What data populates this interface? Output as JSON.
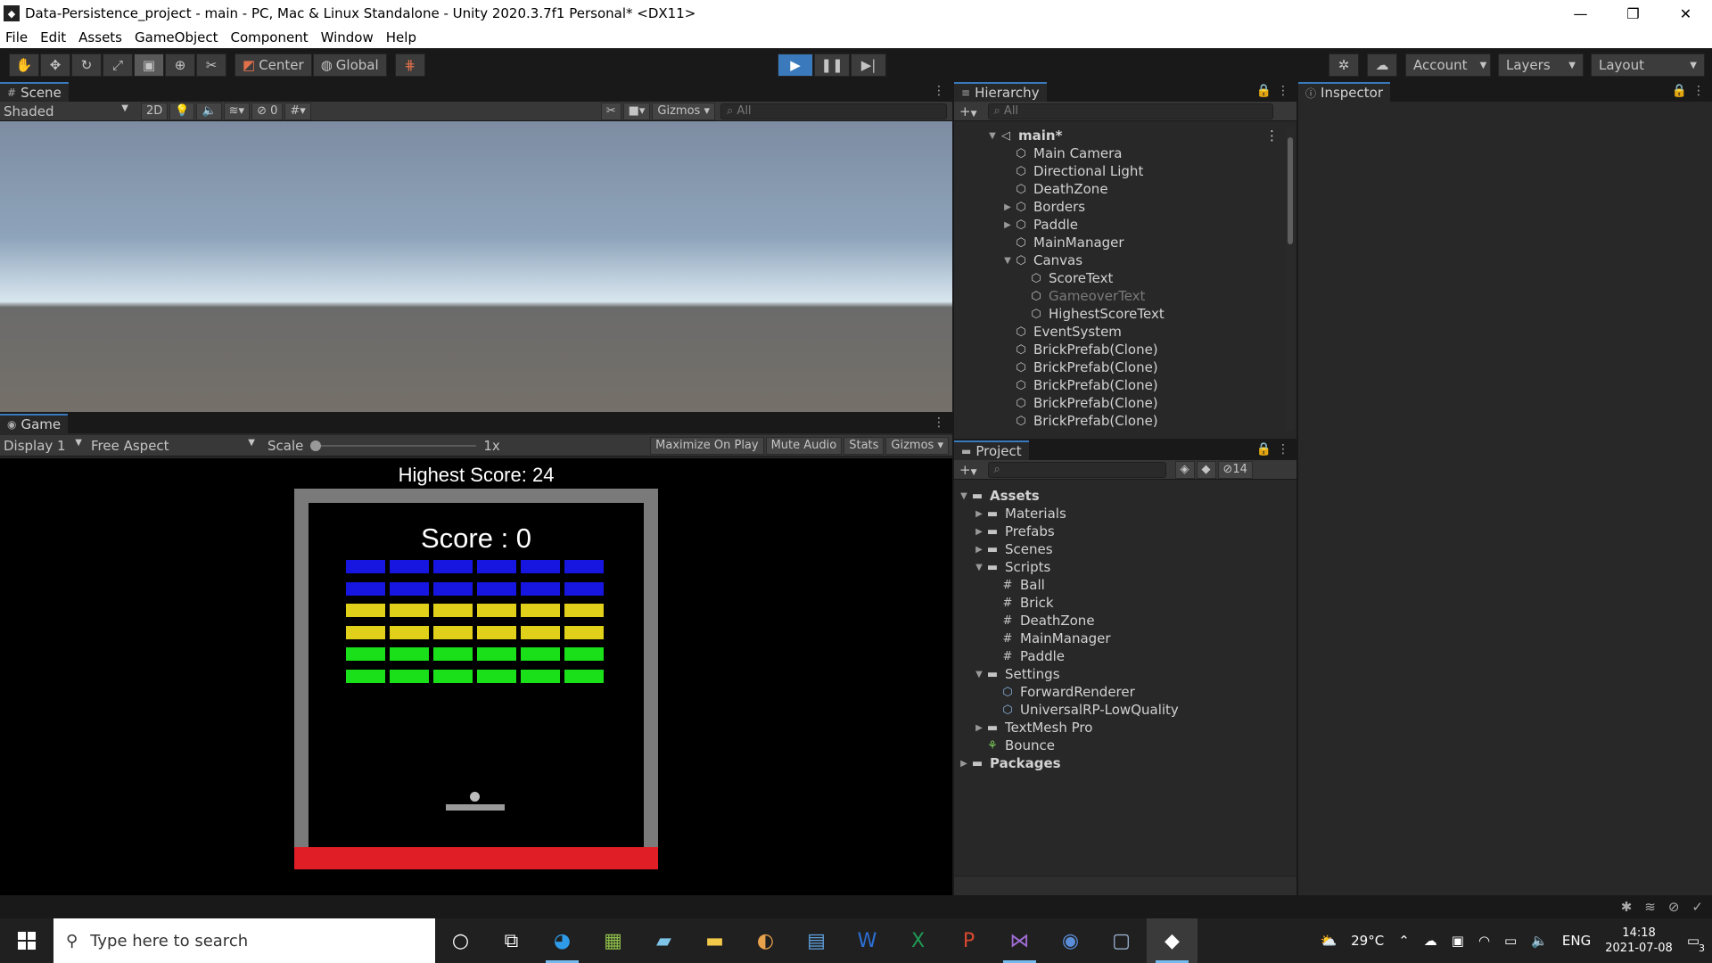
{
  "window": {
    "title": "Data-Persistence_project - main - PC, Mac & Linux Standalone - Unity 2020.3.7f1 Personal* <DX11>"
  },
  "menu": [
    "File",
    "Edit",
    "Assets",
    "GameObject",
    "Component",
    "Window",
    "Help"
  ],
  "toolbar": {
    "pivot": "Center",
    "space": "Global",
    "account": "Account",
    "layers": "Layers",
    "layout": "Layout"
  },
  "scene": {
    "tab": "Scene",
    "shading": "Shaded",
    "mode2d": "2D",
    "hidden_count": "0",
    "gizmos": "Gizmos",
    "search": "All"
  },
  "game": {
    "tab": "Game",
    "display": "Display 1",
    "aspect": "Free Aspect",
    "scale_label": "Scale",
    "scale_value": "1x",
    "maximize": "Maximize On Play",
    "mute": "Mute Audio",
    "stats": "Stats",
    "gizmos": "Gizmos",
    "highest_score": "Highest Score: 24",
    "score": "Score : 0",
    "brick_rows": [
      "#1616e0",
      "#1616e0",
      "#e0d01a",
      "#e0d01a",
      "#19e019",
      "#19e019"
    ],
    "brick_columns": 6
  },
  "hierarchy": {
    "tab": "Hierarchy",
    "search": "All",
    "items": [
      {
        "label": "main*",
        "depth": 0,
        "arrow": "▼",
        "bold": true
      },
      {
        "label": "Main Camera",
        "depth": 1,
        "arrow": ""
      },
      {
        "label": "Directional Light",
        "depth": 1,
        "arrow": ""
      },
      {
        "label": "DeathZone",
        "depth": 1,
        "arrow": ""
      },
      {
        "label": "Borders",
        "depth": 1,
        "arrow": "▶"
      },
      {
        "label": "Paddle",
        "depth": 1,
        "arrow": "▶"
      },
      {
        "label": "MainManager",
        "depth": 1,
        "arrow": ""
      },
      {
        "label": "Canvas",
        "depth": 1,
        "arrow": "▼"
      },
      {
        "label": "ScoreText",
        "depth": 2,
        "arrow": ""
      },
      {
        "label": "GameoverText",
        "depth": 2,
        "arrow": "",
        "dim": true
      },
      {
        "label": "HighestScoreText",
        "depth": 2,
        "arrow": ""
      },
      {
        "label": "EventSystem",
        "depth": 1,
        "arrow": ""
      },
      {
        "label": "BrickPrefab(Clone)",
        "depth": 1,
        "arrow": ""
      },
      {
        "label": "BrickPrefab(Clone)",
        "depth": 1,
        "arrow": ""
      },
      {
        "label": "BrickPrefab(Clone)",
        "depth": 1,
        "arrow": ""
      },
      {
        "label": "BrickPrefab(Clone)",
        "depth": 1,
        "arrow": ""
      },
      {
        "label": "BrickPrefab(Clone)",
        "depth": 1,
        "arrow": ""
      }
    ]
  },
  "project": {
    "tab": "Project",
    "hidden_count": "14",
    "items": [
      {
        "label": "Assets",
        "depth": 0,
        "arrow": "▼",
        "icon": "folder",
        "bold": true
      },
      {
        "label": "Materials",
        "depth": 1,
        "arrow": "▶",
        "icon": "folder"
      },
      {
        "label": "Prefabs",
        "depth": 1,
        "arrow": "▶",
        "icon": "folder"
      },
      {
        "label": "Scenes",
        "depth": 1,
        "arrow": "▶",
        "icon": "folder"
      },
      {
        "label": "Scripts",
        "depth": 1,
        "arrow": "▼",
        "icon": "folder"
      },
      {
        "label": "Ball",
        "depth": 2,
        "arrow": "",
        "icon": "script"
      },
      {
        "label": "Brick",
        "depth": 2,
        "arrow": "",
        "icon": "script"
      },
      {
        "label": "DeathZone",
        "depth": 2,
        "arrow": "",
        "icon": "script"
      },
      {
        "label": "MainManager",
        "depth": 2,
        "arrow": "",
        "icon": "script"
      },
      {
        "label": "Paddle",
        "depth": 2,
        "arrow": "",
        "icon": "script"
      },
      {
        "label": "Settings",
        "depth": 1,
        "arrow": "▼",
        "icon": "folder"
      },
      {
        "label": "ForwardRenderer",
        "depth": 2,
        "arrow": "",
        "icon": "asset"
      },
      {
        "label": "UniversalRP-LowQuality",
        "depth": 2,
        "arrow": "",
        "icon": "asset"
      },
      {
        "label": "TextMesh Pro",
        "depth": 1,
        "arrow": "▶",
        "icon": "folder"
      },
      {
        "label": "Bounce",
        "depth": 1,
        "arrow": "",
        "icon": "physics"
      },
      {
        "label": "Packages",
        "depth": 0,
        "arrow": "▶",
        "icon": "folder",
        "bold": true
      }
    ]
  },
  "inspector": {
    "tab": "Inspector"
  },
  "taskbar": {
    "search_placeholder": "Type here to search",
    "weather": "29°C",
    "lang": "ENG",
    "time": "14:18",
    "date": "2021-07-08",
    "notifications": "3"
  }
}
